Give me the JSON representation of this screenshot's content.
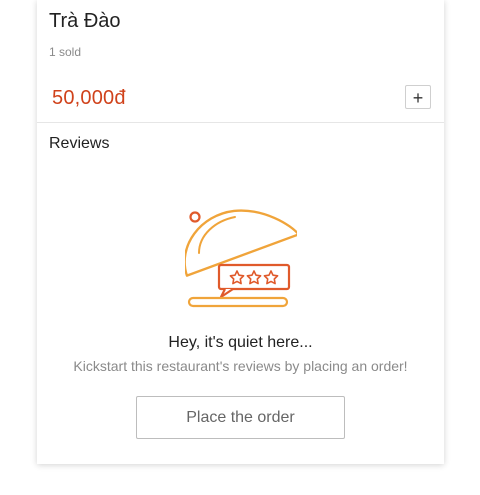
{
  "product": {
    "name": "Trà Đào",
    "sold": "1 sold",
    "price": "50,000đ",
    "add_label": "+"
  },
  "reviews": {
    "heading": "Reviews",
    "empty_title": "Hey, it's quiet here...",
    "empty_description": "Kickstart this restaurant's reviews by placing an order!",
    "cta_label": "Place the order",
    "illustration_icon": "food-cloche-rating-icon"
  },
  "colors": {
    "price": "#d0421b",
    "illustration_primary": "#f0a43a",
    "illustration_accent": "#e05a2b"
  }
}
